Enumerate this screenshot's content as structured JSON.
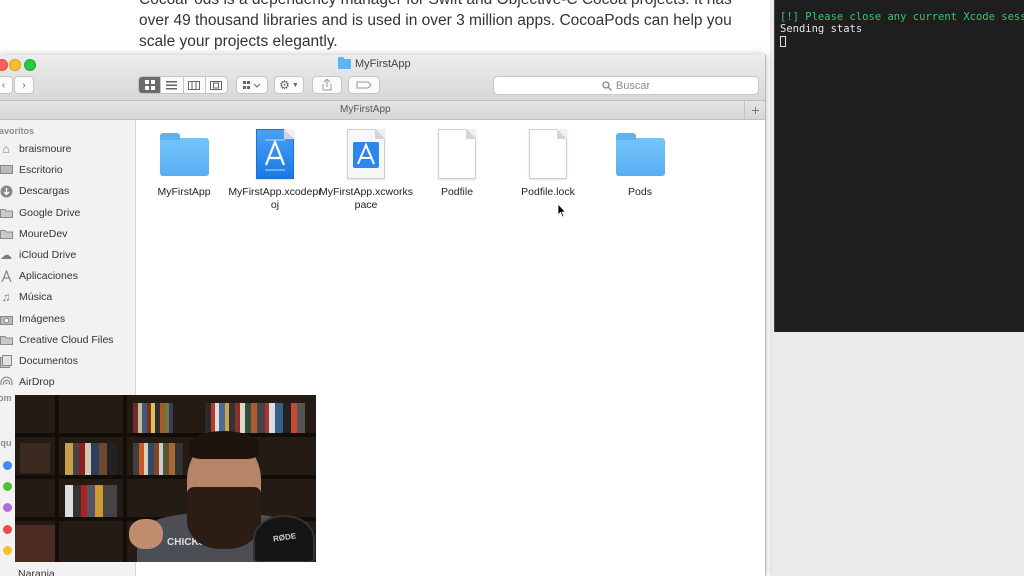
{
  "webpage": {
    "text": "CocoaPods is a dependency manager for Swift and Objective-C Cocoa projects. It has over 49 thousand libraries and is used in over 3 million apps. CocoaPods can help you scale your projects elegantly."
  },
  "terminal": {
    "line1": "[!] Please close any current Xcode sessions",
    "line2": "Sending stats"
  },
  "finder": {
    "window_title": "MyFirstApp",
    "path_title": "MyFirstApp",
    "search_placeholder": "Buscar",
    "add_tab": "+",
    "sidebar": {
      "favorites_header": "avoritos",
      "items": [
        {
          "label": "braismoure",
          "icon": "home-icon"
        },
        {
          "label": "Escritorio",
          "icon": "desktop-icon"
        },
        {
          "label": "Descargas",
          "icon": "downloads-icon"
        },
        {
          "label": "Google Drive",
          "icon": "folder-icon"
        },
        {
          "label": "MoureDev",
          "icon": "folder-icon"
        },
        {
          "label": "iCloud Drive",
          "icon": "cloud-icon"
        },
        {
          "label": "Aplicaciones",
          "icon": "applications-icon"
        },
        {
          "label": "Música",
          "icon": "music-icon"
        },
        {
          "label": "Imágenes",
          "icon": "camera-icon"
        },
        {
          "label": "Creative Cloud Files",
          "icon": "folder-icon"
        },
        {
          "label": "Documentos",
          "icon": "documents-icon"
        },
        {
          "label": "AirDrop",
          "icon": "airdrop-icon"
        }
      ],
      "devices_header": "om",
      "tags_header": "iqu",
      "tag_colors": [
        "#3d8ef0",
        "#4cc23c",
        "#b36ad9",
        "#ee4a46",
        "#f5c02a"
      ],
      "last_item": "Naranja"
    },
    "files": [
      {
        "name": "MyFirstApp",
        "kind": "folder"
      },
      {
        "name": "MyFirstApp.xcodeproj",
        "kind": "xcodeproj"
      },
      {
        "name": "MyFirstApp.xcworkspace",
        "kind": "xcworkspace"
      },
      {
        "name": "Podfile",
        "kind": "document"
      },
      {
        "name": "Podfile.lock",
        "kind": "document"
      },
      {
        "name": "Pods",
        "kind": "folder"
      }
    ]
  },
  "webcam": {
    "shirt_text": "CHICKS DIG",
    "mic_brand": "RØDE"
  }
}
